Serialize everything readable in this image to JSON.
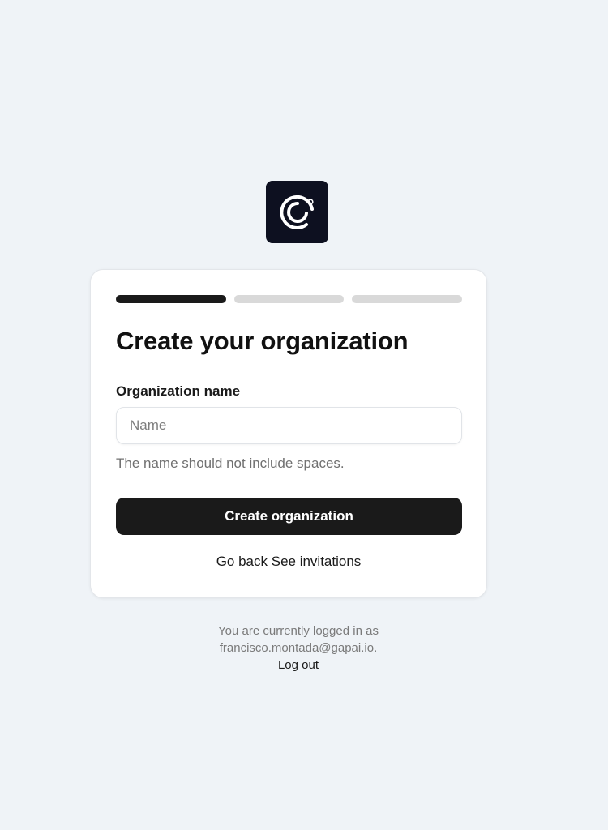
{
  "logo": {
    "icon": "brand-logo-icon",
    "bg_color": "#0d1020"
  },
  "progress": {
    "total_steps": 3,
    "current_step": 1
  },
  "card": {
    "title": "Create your organization",
    "field_label": "Organization name",
    "name_input": {
      "value": "",
      "placeholder": "Name"
    },
    "hint": "The name should not include spaces.",
    "primary_button": "Create organization",
    "go_back": "Go back",
    "see_invitations": "See invitations"
  },
  "footer": {
    "logged_in_text": "You are currently logged in as",
    "email": "francisco.montada@gapai.io.",
    "logout": "Log out"
  },
  "colors": {
    "background": "#eff3f7",
    "primary": "#1a1a1a",
    "step_inactive": "#d9d9d9"
  }
}
